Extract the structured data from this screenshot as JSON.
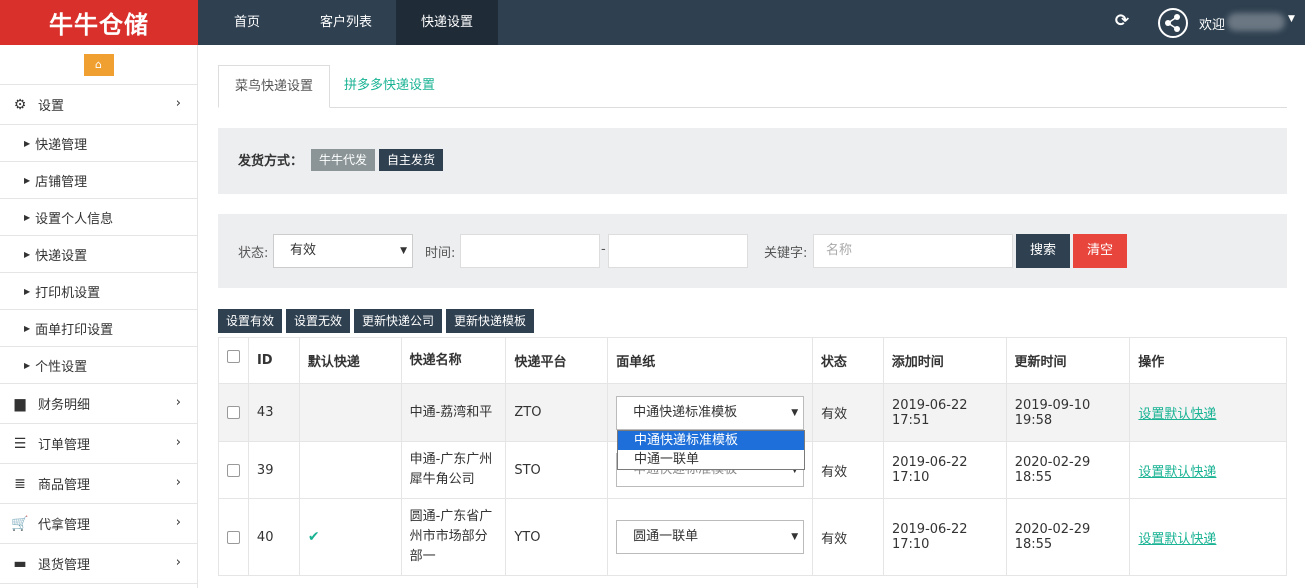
{
  "logo": {
    "text": "牛牛仓储"
  },
  "topnav": {
    "items": [
      "首页",
      "客户列表",
      "快递设置"
    ]
  },
  "topbar": {
    "welcome": "欢迎"
  },
  "sidebar": {
    "settings_label": "设置",
    "sub_items": [
      "快递管理",
      "店铺管理",
      "设置个人信息",
      "快递设置",
      "打印机设置",
      "面单打印设置",
      "个性设置"
    ],
    "menus": [
      "财务明细",
      "订单管理",
      "商品管理",
      "代拿管理",
      "退货管理"
    ]
  },
  "tabs": [
    "菜鸟快递设置",
    "拼多多快递设置"
  ],
  "shipping": {
    "label": "发货方式：",
    "options": [
      "牛牛代发",
      "自主发货"
    ]
  },
  "filters": {
    "status_label": "状态:",
    "status_value": "有效",
    "time_label": "时间:",
    "time_sep": "-",
    "keyword_label": "关键字:",
    "keyword_placeholder": "名称",
    "search_label": "搜索",
    "clear_label": "清空"
  },
  "actions": [
    "设置有效",
    "设置无效",
    "更新快递公司",
    "更新快递模板"
  ],
  "table": {
    "headers": [
      "ID",
      "默认快递",
      "快递名称",
      "快递平台",
      "面单纸",
      "状态",
      "添加时间",
      "更新时间",
      "操作"
    ],
    "rows": [
      {
        "id": "43",
        "default": "",
        "name": "中通-荔湾和平",
        "platform": "ZTO",
        "template": "中通快递标准模板",
        "status": "有效",
        "added": "2019-06-22 17:51",
        "updated": "2019-09-10 19:58",
        "op": "设置默认快递"
      },
      {
        "id": "39",
        "default": "",
        "name": "申通-广东广州犀牛角公司",
        "platform": "STO",
        "template": "申通快递标准模板",
        "status": "有效",
        "added": "2019-06-22 17:10",
        "updated": "2020-02-29 18:55",
        "op": "设置默认快递"
      },
      {
        "id": "40",
        "default": "check",
        "name": "圆通-广东省广州市市场部分部一",
        "platform": "YTO",
        "template": "圆通一联单",
        "status": "有效",
        "added": "2019-06-22 17:10",
        "updated": "2020-02-29 18:55",
        "op": "设置默认快递"
      }
    ]
  },
  "dropdown": {
    "options": [
      "中通快递标准模板",
      "中通一联单"
    ],
    "selected_index": 0
  },
  "colors": {
    "topbar": "#2f4050",
    "logo": "#d9302c",
    "accent": "#1ab394",
    "danger": "#e8453c",
    "home": "#f0a030"
  }
}
